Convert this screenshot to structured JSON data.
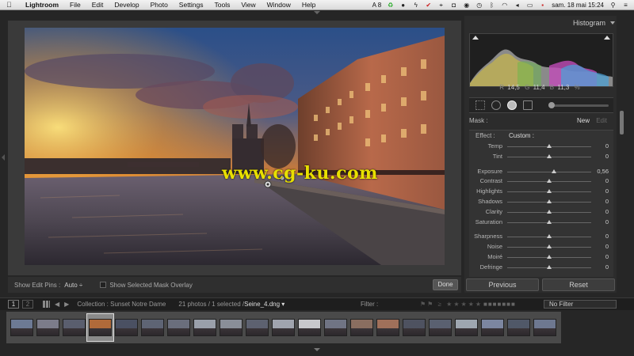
{
  "menubar": {
    "app_name": "Lightroom",
    "items": [
      "File",
      "Edit",
      "Develop",
      "Photo",
      "Settings",
      "Tools",
      "View",
      "Window",
      "Help"
    ],
    "status_a": "A 8",
    "datetime": "sam. 18 mai  15:24"
  },
  "image": {
    "watermark": "www.cg-ku.com"
  },
  "toolbar": {
    "show_edit_pins_label": "Show Edit Pins :",
    "show_edit_pins_value": "Auto ÷",
    "mask_overlay_label": "Show Selected Mask Overlay",
    "done_label": "Done"
  },
  "panel": {
    "histogram_title": "Histogram",
    "hist": {
      "r_label": "R",
      "r": "14,5",
      "g_label": "G",
      "g": "11,4",
      "b_label": "B",
      "b": "11,3",
      "unit": "%"
    },
    "mask_label": "Mask :",
    "new_label": "New",
    "edit_label": "Edit",
    "effect_label": "Effect :",
    "effect_value": "Custom :",
    "sliders_a": [
      {
        "label": "Temp",
        "value": "0",
        "pos": 0.5
      },
      {
        "label": "Tint",
        "value": "0",
        "pos": 0.5
      }
    ],
    "sliders_b": [
      {
        "label": "Exposure",
        "value": "0,56",
        "pos": 0.56
      },
      {
        "label": "Contrast",
        "value": "0",
        "pos": 0.5
      },
      {
        "label": "Highlights",
        "value": "0",
        "pos": 0.5
      },
      {
        "label": "Shadows",
        "value": "0",
        "pos": 0.5
      },
      {
        "label": "Clarity",
        "value": "0",
        "pos": 0.5
      },
      {
        "label": "Saturation",
        "value": "0",
        "pos": 0.5
      }
    ],
    "sliders_c": [
      {
        "label": "Sharpness",
        "value": "0",
        "pos": 0.5
      },
      {
        "label": "Noise",
        "value": "0",
        "pos": 0.5
      },
      {
        "label": "Moiré",
        "value": "0",
        "pos": 0.5
      },
      {
        "label": "Defringe",
        "value": "0",
        "pos": 0.5
      }
    ],
    "previous_label": "Previous",
    "reset_label": "Reset"
  },
  "filmbar": {
    "page1": "1",
    "page2": "2",
    "collection": "Collection : Sunset Notre Dame",
    "count": "21 photos / 1 selected /",
    "filename": "Seine_4.dng ▾",
    "filter_label": "Filter :",
    "filter_value": "No Filter"
  },
  "filmstrip": {
    "thumbnail_count": 21,
    "selected_index": 3
  }
}
